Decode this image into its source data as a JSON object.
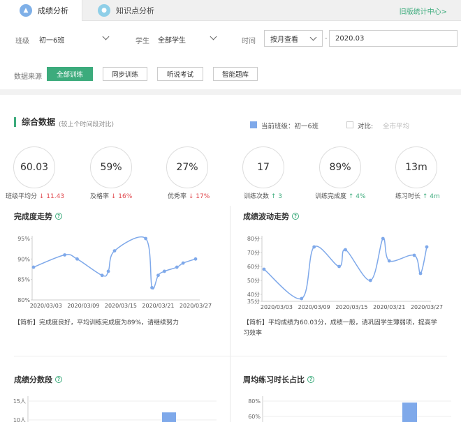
{
  "tabs": [
    {
      "label": "成绩分析",
      "active": true
    },
    {
      "label": "知识点分析",
      "active": false
    }
  ],
  "old_stats_link": "旧版统计中心>",
  "filters": {
    "class_label": "班级",
    "class_value": "初一6班",
    "student_label": "学生",
    "student_value": "全部学生",
    "time_label": "时间",
    "time_mode": "按月查看",
    "time_value": "2020.03",
    "source_label": "数据来源",
    "sources": [
      "全部训练",
      "同步训练",
      "听说考试",
      "智能题库"
    ],
    "active_source": "全部训练"
  },
  "summary": {
    "title": "综合数据",
    "subtitle": "(较上个时间段对比)",
    "current_class_label": "当前班级：初一6班",
    "compare_label": "对比:",
    "compare_value": "全市平均",
    "kpis": [
      {
        "value": "60.03",
        "label": "班级平均分",
        "change": "↓ 11.43",
        "dir": "down"
      },
      {
        "value": "59%",
        "label": "及格率",
        "change": "↓ 16%",
        "dir": "down"
      },
      {
        "value": "27%",
        "label": "优秀率",
        "change": "↓ 17%",
        "dir": "down"
      },
      {
        "value": "17",
        "label": "训练次数",
        "change": "↑ 3",
        "dir": "up"
      },
      {
        "value": "89%",
        "label": "训练完成度",
        "change": "↑ 4%",
        "dir": "up"
      },
      {
        "value": "13m",
        "label": "练习时长",
        "change": "↑ 4m",
        "dir": "up"
      }
    ]
  },
  "cards": {
    "completion_title": "完成度走势",
    "completion_analysis": "【简析】完成度良好，平均训练完成度为89%，请继续努力",
    "score_title": "成绩波动走势",
    "score_analysis_1": "【简析】平均成绩为60.03分，成绩一般，请巩固学生薄弱项，提高学",
    "score_analysis_2": "习效率",
    "segment_title": "成绩分数段",
    "weekly_title": "周均练习时长占比"
  },
  "colors": {
    "accent": "#3cab7c",
    "series": "#7fa9ea",
    "down": "#e0464b"
  },
  "chart_data": [
    {
      "type": "line",
      "title": "完成度走势",
      "x": [
        "2020/03/01",
        "2020/03/06",
        "2020/03/08",
        "2020/03/12",
        "2020/03/13",
        "2020/03/14",
        "2020/03/19",
        "2020/03/20",
        "2020/03/21",
        "2020/03/22",
        "2020/03/24",
        "2020/03/25",
        "2020/03/27"
      ],
      "values": [
        88,
        91,
        90,
        86,
        87,
        92,
        95,
        83,
        86,
        87,
        88,
        89,
        90
      ],
      "ylim": [
        80,
        95
      ],
      "yticks": [
        "80%",
        "85%",
        "90%",
        "95%"
      ],
      "xticks": [
        "2020/03/03",
        "2020/03/09",
        "2020/03/15",
        "2020/03/21",
        "2020/03/27"
      ],
      "smooth": true
    },
    {
      "type": "line",
      "title": "成绩波动走势",
      "x": [
        "2020/03/01",
        "2020/03/07",
        "2020/03/09",
        "2020/03/13",
        "2020/03/14",
        "2020/03/18",
        "2020/03/20",
        "2020/03/21",
        "2020/03/25",
        "2020/03/26",
        "2020/03/27"
      ],
      "values": [
        58,
        37,
        74,
        60,
        72,
        50,
        80,
        64,
        68,
        55,
        74
      ],
      "ylim": [
        35,
        80
      ],
      "yticks": [
        "35分",
        "40分",
        "50分",
        "60分",
        "70分",
        "80分"
      ],
      "xticks": [
        "2020/03/03",
        "2020/03/09",
        "2020/03/15",
        "2020/03/21",
        "2020/03/27"
      ],
      "smooth": true
    },
    {
      "type": "bar",
      "title": "成绩分数段",
      "yticks": [
        "15人",
        "10人"
      ],
      "values": [
        12
      ]
    },
    {
      "type": "bar",
      "title": "周均练习时长占比",
      "yticks": [
        "80%",
        "60%"
      ],
      "values": [
        78
      ]
    }
  ]
}
